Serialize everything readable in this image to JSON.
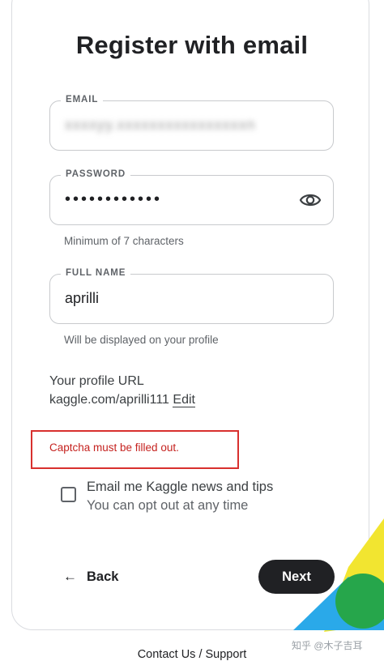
{
  "form": {
    "title": "Register with email",
    "email": {
      "label": "EMAIL",
      "value": "xxxxyy.xxxxxxxxxxxxxxxxn"
    },
    "password": {
      "label": "PASSWORD",
      "value": "••••••••••••",
      "hint": "Minimum of 7 characters",
      "toggle_icon": "eye-icon"
    },
    "full_name": {
      "label": "FULL NAME",
      "value": "aprilli",
      "hint": "Will be displayed on your profile"
    },
    "profile_url": {
      "label": "Your profile URL",
      "value": "kaggle.com/aprilli111",
      "edit_label": "Edit"
    },
    "error": {
      "message": "Captcha must be filled out.",
      "color": "#c5221f"
    },
    "newsletter": {
      "checked": false,
      "label": "Email me Kaggle news and tips",
      "sublabel": "You can opt out at any time"
    },
    "back_label": "Back",
    "back_icon": "arrow-left-icon",
    "next_label": "Next"
  },
  "footer": {
    "link": "Contact Us / Support"
  },
  "watermark": {
    "text": "知乎 @木子吉耳"
  },
  "colors": {
    "primary_button": "#202124",
    "decoration_yellow": "#f2e530",
    "decoration_blue": "#2aa9e9",
    "decoration_green": "#26a64b"
  }
}
